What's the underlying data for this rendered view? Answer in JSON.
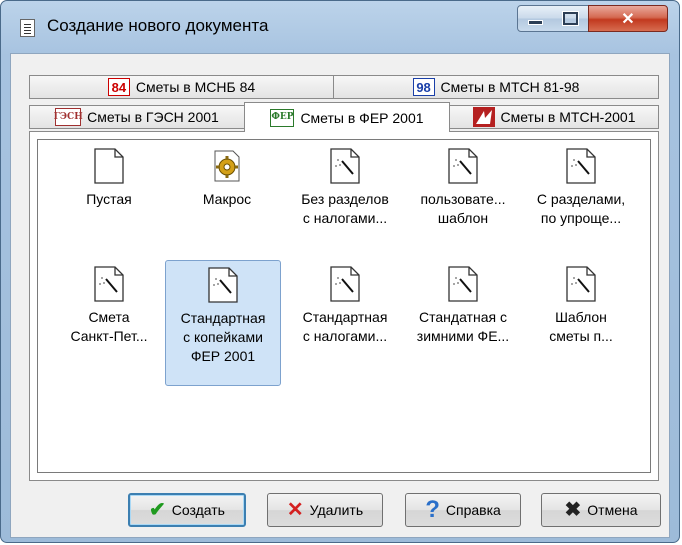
{
  "window": {
    "title": "Создание нового документа"
  },
  "tabs": {
    "row_back": [
      {
        "label": "Сметы в МСНБ 84",
        "icon": "84"
      },
      {
        "label": "Сметы в МТСН 81-98",
        "icon": "98"
      }
    ],
    "row_front": [
      {
        "label": "Сметы в ГЭСН 2001",
        "icon": "ГЭСН"
      },
      {
        "label": "Сметы в ФЕР 2001",
        "icon": "ФЕР",
        "active": true
      },
      {
        "label": "Сметы в МТСН-2001",
        "icon": "mtsn-icon"
      }
    ]
  },
  "templates": [
    {
      "name": "Пустая",
      "icon": "blank-doc-icon"
    },
    {
      "name": "Макрос",
      "icon": "macro-gear-icon"
    },
    {
      "name": "Без разделов с налогами...",
      "line1": "Без разделов",
      "line2": "с налогами...",
      "icon": "wizard-doc-icon"
    },
    {
      "line1": "пользовате...",
      "line2": "шаблон",
      "icon": "wizard-doc-icon"
    },
    {
      "line1": "С разделами,",
      "line2": "по упроще...",
      "icon": "wizard-doc-icon"
    },
    {
      "line1": "Смета",
      "line2": "Санкт-Пет...",
      "icon": "wizard-doc-icon"
    },
    {
      "line1": "Стандартная",
      "line2": "с копейками",
      "line3": "ФЕР 2001",
      "icon": "wizard-doc-icon",
      "selected": true
    },
    {
      "line1": "Стандартная",
      "line2": "с налогами...",
      "icon": "wizard-doc-icon"
    },
    {
      "line1": "Стандатная с",
      "line2": "зимними ФЕ...",
      "icon": "wizard-doc-icon"
    },
    {
      "line1": "Шаблон",
      "line2": "сметы п...",
      "icon": "wizard-doc-icon"
    }
  ],
  "buttons": {
    "create": "Создать",
    "delete": "Удалить",
    "help": "Справка",
    "cancel": "Отмена"
  },
  "colors": {
    "create_check": "#1f9a1f",
    "delete_x": "#d42020",
    "help_q": "#2a6fc9",
    "cancel_x": "#222222"
  }
}
